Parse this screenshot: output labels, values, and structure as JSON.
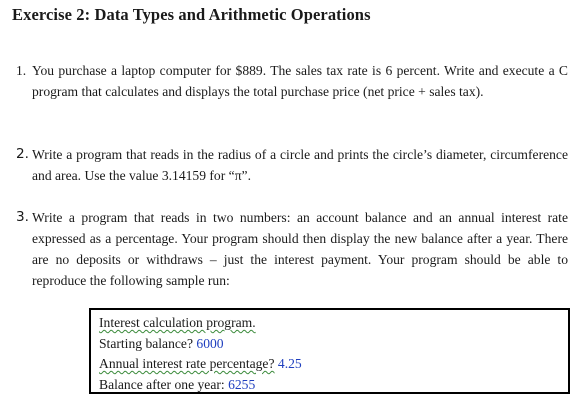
{
  "title": "Exercise 2: Data Types and Arithmetic Operations",
  "exercises": [
    {
      "number": "1.",
      "text": "You purchase a laptop computer for $889. The sales tax rate is 6 percent. Write and execute a C program that calculates and displays the total purchase price (net price + sales tax)."
    },
    {
      "number": "2.",
      "text": "Write a program that reads in the radius of a circle and prints the circle’s diameter, circumference and area. Use the value 3.14159 for “π”."
    },
    {
      "number": "3.",
      "text": "Write a program that reads in two numbers: an account balance and an annual interest rate expressed as a percentage. Your program should then display the new balance after a year. There are no deposits or withdraws – just the interest payment. Your program should be able to reproduce the following sample run:"
    }
  ],
  "sample_run": {
    "header": "Interest calculation program.",
    "balance_prompt": "Starting balance?",
    "balance_value": "6000",
    "rate_prompt": "Annual interest rate percentage?",
    "rate_value": "4.25",
    "result_label": "Balance after one year:",
    "result_value": "6255",
    "input_color": "#1f3fbf"
  }
}
